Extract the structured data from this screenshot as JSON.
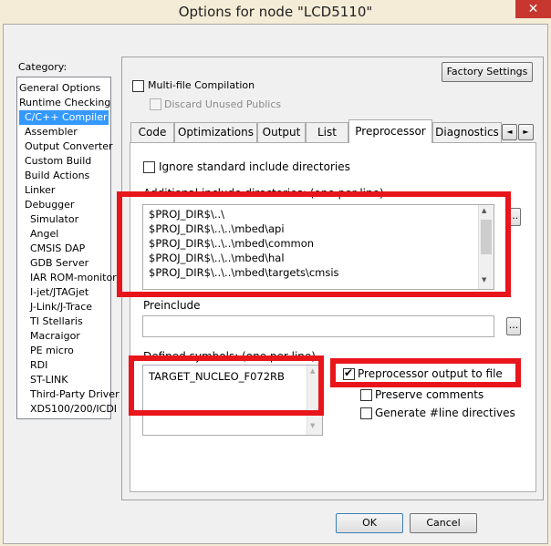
{
  "window": {
    "title": "Options for node \"LCD5110\"",
    "close_glyph": "✕"
  },
  "category": {
    "label": "Category:",
    "items": [
      "General Options",
      "Runtime Checking",
      "C/C++ Compiler",
      "Assembler",
      "Output Converter",
      "Custom Build",
      "Build Actions",
      "Linker",
      "Debugger",
      "Simulator",
      "Angel",
      "CMSIS DAP",
      "GDB Server",
      "IAR ROM-monitor",
      "I-jet/JTAGjet",
      "J-Link/J-Trace",
      "TI Stellaris",
      "Macraigor",
      "PE micro",
      "RDI",
      "ST-LINK",
      "Third-Party Driver",
      "XDS100/200/ICDI"
    ],
    "selected": "C/C++ Compiler"
  },
  "panel": {
    "factory_settings": "Factory Settings",
    "multifile": "Multi-file Compilation",
    "discard": "Discard Unused Publics",
    "tabs": [
      "Code",
      "Optimizations",
      "Output",
      "List",
      "Preprocessor",
      "Diagnostics"
    ],
    "active_tab": "Preprocessor",
    "tab_scroll_left": "◄",
    "tab_scroll_right": "►"
  },
  "preprocessor": {
    "ignore_std": "Ignore standard include directories",
    "additional_label": "Additional include directories: (one per line)",
    "include_dirs": [
      "$PROJ_DIR$\\..\\",
      "$PROJ_DIR$\\..\\..\\mbed\\api",
      "$PROJ_DIR$\\..\\..\\mbed\\common",
      "$PROJ_DIR$\\..\\..\\mbed\\hal",
      "$PROJ_DIR$\\..\\..\\mbed\\targets\\cmsis"
    ],
    "browse": "...",
    "preinclude_label": "Preinclude",
    "preinclude_value": "",
    "defined_label": "Defined symbols: (one per line)",
    "defined_symbols": [
      "TARGET_NUCLEO_F072RB"
    ],
    "pp_output": "Preprocessor output to file",
    "pp_output_checked": true,
    "preserve_comments": "Preserve comments",
    "generate_line": "Generate #line directives"
  },
  "buttons": {
    "ok": "OK",
    "cancel": "Cancel"
  },
  "scroll": {
    "up": "▲",
    "down": "▼"
  }
}
